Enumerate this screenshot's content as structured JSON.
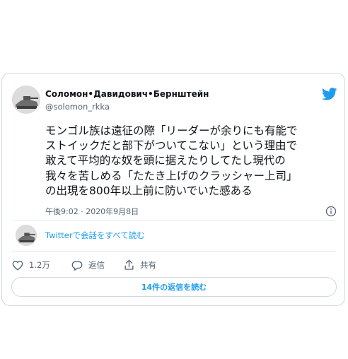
{
  "tweet": {
    "author": {
      "name": "Соломон•Давидович•Бернштейн",
      "handle": "@solomon_rkka"
    },
    "text_lines": [
      "モンゴル族は遠征の際「リーダーが余りにも有能で",
      "ストイックだと部下がついてこない」という理由で",
      "敢えて平均的な奴を頭に据えたりしてたし現代の",
      "我々を苦しめる「たたき上げのクラッシャー上司」",
      "の出現を800年以上前に防いでいた感ある"
    ],
    "timestamp": "午後9:02 · 2020年9月8日",
    "conversation_link": "Twitterで会話をすべて読む",
    "actions": {
      "likes": "1.2万",
      "reply_label": "返信",
      "share_label": "共有"
    },
    "read_replies": "14件の返信を読む"
  },
  "colors": {
    "accent": "#1d9bf0",
    "text": "#0f1419",
    "secondary": "#536471",
    "border": "#cfd9de"
  },
  "icons": [
    "twitter-bird-icon",
    "info-icon",
    "heart-icon",
    "reply-icon",
    "share-icon"
  ]
}
